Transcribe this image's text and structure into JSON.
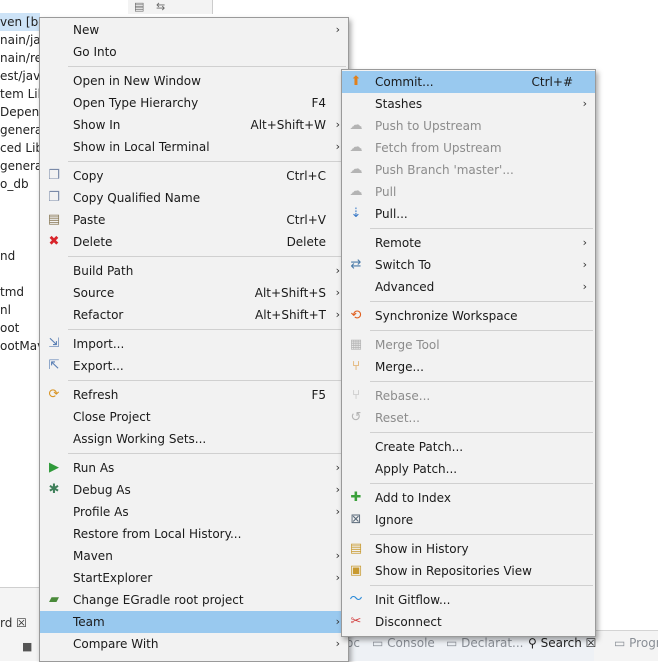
{
  "background": {
    "tree_rows": [
      "ven [bo",
      "nain/jav",
      "nain/res",
      "est/java",
      "tem Lib",
      "Depend",
      "generat",
      "ced Lib",
      "generat",
      "o_db",
      "",
      "",
      "nd",
      "",
      "tmd",
      "nl",
      "oot",
      "ootMav"
    ],
    "left_panel_tab": "rd",
    "left_panel_tab_close": "☒",
    "left_panel_controls": "■",
    "bottom_tabs": [
      "Console",
      "Declarat...",
      "Search",
      "Progr"
    ],
    "bottom_tab_prefix": "oc",
    "search_tab_close": "☒"
  },
  "main_menu": [
    {
      "label": "New",
      "shortcut": "",
      "submenu": true,
      "icon": "",
      "icon_name": "none"
    },
    {
      "label": "Go Into",
      "shortcut": "",
      "submenu": false,
      "icon": "",
      "icon_name": "none"
    },
    {
      "sep": true
    },
    {
      "label": "Open in New Window",
      "shortcut": "",
      "submenu": false,
      "icon": "",
      "icon_name": "none"
    },
    {
      "label": "Open Type Hierarchy",
      "shortcut": "F4",
      "submenu": false,
      "icon": "",
      "icon_name": "none"
    },
    {
      "label": "Show In",
      "shortcut": "Alt+Shift+W",
      "submenu": true,
      "icon": "",
      "icon_name": "none"
    },
    {
      "label": "Show in Local Terminal",
      "shortcut": "",
      "submenu": true,
      "icon": "",
      "icon_name": "none"
    },
    {
      "sep": true
    },
    {
      "label": "Copy",
      "shortcut": "Ctrl+C",
      "submenu": false,
      "icon": "❐",
      "icon_name": "copy-icon",
      "color": "#7a8aa8"
    },
    {
      "label": "Copy Qualified Name",
      "shortcut": "",
      "submenu": false,
      "icon": "❐",
      "icon_name": "copy-qualified-name-icon",
      "color": "#7a8aa8"
    },
    {
      "label": "Paste",
      "shortcut": "Ctrl+V",
      "submenu": false,
      "icon": "▤",
      "icon_name": "paste-icon",
      "color": "#8a7a58"
    },
    {
      "label": "Delete",
      "shortcut": "Delete",
      "submenu": false,
      "icon": "✖",
      "icon_name": "delete-icon",
      "color": "#d8242a"
    },
    {
      "sep": true
    },
    {
      "label": "Build Path",
      "shortcut": "",
      "submenu": true,
      "icon": "",
      "icon_name": "none"
    },
    {
      "label": "Source",
      "shortcut": "Alt+Shift+S",
      "submenu": true,
      "icon": "",
      "icon_name": "none"
    },
    {
      "label": "Refactor",
      "shortcut": "Alt+Shift+T",
      "submenu": true,
      "icon": "",
      "icon_name": "none"
    },
    {
      "sep": true
    },
    {
      "label": "Import...",
      "shortcut": "",
      "submenu": false,
      "icon": "⇲",
      "icon_name": "import-icon",
      "color": "#5a7fb4"
    },
    {
      "label": "Export...",
      "shortcut": "",
      "submenu": false,
      "icon": "⇱",
      "icon_name": "export-icon",
      "color": "#5a7fb4"
    },
    {
      "sep": true
    },
    {
      "label": "Refresh",
      "shortcut": "F5",
      "submenu": false,
      "icon": "⟳",
      "icon_name": "refresh-icon",
      "color": "#d99423"
    },
    {
      "label": "Close Project",
      "shortcut": "",
      "submenu": false,
      "icon": "",
      "icon_name": "none"
    },
    {
      "label": "Assign Working Sets...",
      "shortcut": "",
      "submenu": false,
      "icon": "",
      "icon_name": "none"
    },
    {
      "sep": true
    },
    {
      "label": "Run As",
      "shortcut": "",
      "submenu": true,
      "icon": "▶",
      "icon_name": "run-icon",
      "color": "#2f9a3a"
    },
    {
      "label": "Debug As",
      "shortcut": "",
      "submenu": true,
      "icon": "✱",
      "icon_name": "debug-icon",
      "color": "#3f7f5a"
    },
    {
      "label": "Profile As",
      "shortcut": "",
      "submenu": true,
      "icon": "",
      "icon_name": "none"
    },
    {
      "label": "Restore from Local History...",
      "shortcut": "",
      "submenu": false,
      "icon": "",
      "icon_name": "none"
    },
    {
      "label": "Maven",
      "shortcut": "",
      "submenu": true,
      "icon": "",
      "icon_name": "none"
    },
    {
      "label": "StartExplorer",
      "shortcut": "",
      "submenu": true,
      "icon": "",
      "icon_name": "none"
    },
    {
      "label": "Change EGradle root project",
      "shortcut": "",
      "submenu": false,
      "icon": "▰",
      "icon_name": "gradle-folder-icon",
      "color": "#4a8a3a"
    },
    {
      "label": "Team",
      "shortcut": "",
      "submenu": true,
      "icon": "",
      "icon_name": "none",
      "highlight": true
    },
    {
      "label": "Compare With",
      "shortcut": "",
      "submenu": true,
      "icon": "",
      "icon_name": "none"
    }
  ],
  "team_menu": [
    {
      "label": "Commit...",
      "shortcut": "Ctrl+#",
      "submenu": false,
      "icon": "⬆",
      "icon_name": "commit-icon",
      "color": "#e0801c",
      "highlight": true
    },
    {
      "label": "Stashes",
      "shortcut": "",
      "submenu": true,
      "icon": "",
      "icon_name": "none"
    },
    {
      "label": "Push to Upstream",
      "shortcut": "",
      "submenu": false,
      "icon": "☁",
      "icon_name": "push-icon",
      "color": "#b4b4b4",
      "disabled": true
    },
    {
      "label": "Fetch from Upstream",
      "shortcut": "",
      "submenu": false,
      "icon": "☁",
      "icon_name": "fetch-icon",
      "color": "#b4b4b4",
      "disabled": true
    },
    {
      "label": "Push Branch 'master'...",
      "shortcut": "",
      "submenu": false,
      "icon": "☁",
      "icon_name": "push-branch-icon",
      "color": "#b4b4b4",
      "disabled": true
    },
    {
      "label": "Pull",
      "shortcut": "",
      "submenu": false,
      "icon": "☁",
      "icon_name": "pull-icon",
      "color": "#b4b4b4",
      "disabled": true
    },
    {
      "label": "Pull...",
      "shortcut": "",
      "submenu": false,
      "icon": "⇣",
      "icon_name": "pull-dialog-icon",
      "color": "#3a7ac8"
    },
    {
      "sep": true
    },
    {
      "label": "Remote",
      "shortcut": "",
      "submenu": true,
      "icon": "",
      "icon_name": "none"
    },
    {
      "label": "Switch To",
      "shortcut": "",
      "submenu": true,
      "icon": "⇄",
      "icon_name": "switch-branch-icon",
      "color": "#4a7aa8"
    },
    {
      "label": "Advanced",
      "shortcut": "",
      "submenu": true,
      "icon": "",
      "icon_name": "none"
    },
    {
      "sep": true
    },
    {
      "label": "Synchronize Workspace",
      "shortcut": "",
      "submenu": false,
      "icon": "⟲",
      "icon_name": "synchronize-icon",
      "color": "#e06020"
    },
    {
      "sep": true
    },
    {
      "label": "Merge Tool",
      "shortcut": "",
      "submenu": false,
      "icon": "▦",
      "icon_name": "merge-tool-icon",
      "color": "#b4b4b4",
      "disabled": true
    },
    {
      "label": "Merge...",
      "shortcut": "",
      "submenu": false,
      "icon": "⑂",
      "icon_name": "merge-icon",
      "color": "#d98a20"
    },
    {
      "sep": true
    },
    {
      "label": "Rebase...",
      "shortcut": "",
      "submenu": false,
      "icon": "⑂",
      "icon_name": "rebase-icon",
      "color": "#b4b4b4",
      "disabled": true
    },
    {
      "label": "Reset...",
      "shortcut": "",
      "submenu": false,
      "icon": "↺",
      "icon_name": "reset-icon",
      "color": "#b4b4b4",
      "disabled": true
    },
    {
      "sep": true
    },
    {
      "label": "Create Patch...",
      "shortcut": "",
      "submenu": false,
      "icon": "",
      "icon_name": "none"
    },
    {
      "label": "Apply Patch...",
      "shortcut": "",
      "submenu": false,
      "icon": "",
      "icon_name": "none"
    },
    {
      "sep": true
    },
    {
      "label": "Add to Index",
      "shortcut": "",
      "submenu": false,
      "icon": "✚",
      "icon_name": "add-to-index-icon",
      "color": "#3aa03a"
    },
    {
      "label": "Ignore",
      "shortcut": "",
      "submenu": false,
      "icon": "⊠",
      "icon_name": "ignore-icon",
      "color": "#5a6a7a"
    },
    {
      "sep": true
    },
    {
      "label": "Show in History",
      "shortcut": "",
      "submenu": false,
      "icon": "▤",
      "icon_name": "history-icon",
      "color": "#c89a30"
    },
    {
      "label": "Show in Repositories View",
      "shortcut": "",
      "submenu": false,
      "icon": "▣",
      "icon_name": "repositories-icon",
      "color": "#c89a30"
    },
    {
      "sep": true
    },
    {
      "label": "Init Gitflow...",
      "shortcut": "",
      "submenu": false,
      "icon": "〜",
      "icon_name": "gitflow-icon",
      "color": "#2a8ad8"
    },
    {
      "label": "Disconnect",
      "shortcut": "",
      "submenu": false,
      "icon": "✂",
      "icon_name": "disconnect-icon",
      "color": "#d23a3a"
    }
  ],
  "submenu_arrow": "›"
}
